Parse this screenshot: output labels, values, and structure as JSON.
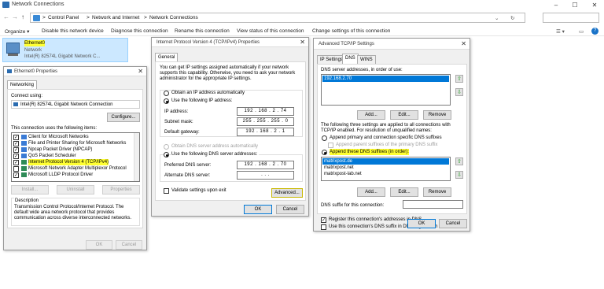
{
  "window": {
    "title": "Network Connections",
    "minimize": "–",
    "maximize": "☐",
    "close": "✕"
  },
  "address": {
    "back": "←",
    "forward": "→",
    "up": "↑",
    "crumbs": [
      "Control Panel",
      ">",
      "Network and Internet",
      ">",
      "Network Connections"
    ],
    "sep": ">",
    "search_placeholder": ""
  },
  "commands": [
    "Organize ▾",
    "Disable this network device",
    "Diagnose this connection",
    "Rename this connection",
    "View status of this connection",
    "Change settings of this connection"
  ],
  "adapter": {
    "name": "Ethernet0",
    "status": "Network",
    "device": "Intel(R) 82574L Gigabit Network C..."
  },
  "props": {
    "title": "Ethernet0 Properties",
    "tab": "Networking",
    "connect_using": "Connect using:",
    "device": "Intel(R) 82574L Gigabit Network Connection",
    "configure": "Configure...",
    "items_label": "This connection uses the following items:",
    "items": [
      "Client for Microsoft Networks",
      "File and Printer Sharing for Microsoft Networks",
      "Npcap Packet Driver (NPCAP)",
      "QoS Packet Scheduler",
      "Internet Protocol Version 4 (TCP/IPv4)",
      "Microsoft Network Adapter Multiplexor Protocol",
      "Microsoft LLDP Protocol Driver"
    ],
    "install": "Install...",
    "uninstall": "Uninstall",
    "properties": "Properties",
    "desc_label": "Description",
    "description": "Transmission Control Protocol/Internet Protocol. The default wide area network protocol that provides communication across diverse interconnected networks.",
    "ok": "OK",
    "cancel": "Cancel"
  },
  "ipv4": {
    "title": "Internet Protocol Version 4 (TCP/IPv4) Properties",
    "tab": "General",
    "intro": "You can get IP settings assigned automatically if your network supports this capability. Otherwise, you need to ask your network administrator for the appropriate IP settings.",
    "auto_ip": "Obtain an IP address automatically",
    "use_ip": "Use the following IP address:",
    "ip_label": "IP address:",
    "ip": "192 . 168 .  2  . 74",
    "mask_label": "Subnet mask:",
    "mask": "255 . 255 . 255 .  0",
    "gw_label": "Default gateway:",
    "gw": "192 . 168 .  2  .  1",
    "auto_dns": "Obtain DNS server address automatically",
    "use_dns": "Use the following DNS server addresses:",
    "pref_label": "Preferred DNS server:",
    "pref": "192 . 168 .  2  . 70",
    "alt_label": "Alternate DNS server:",
    "alt": " .  .  . ",
    "validate": "Validate settings upon exit",
    "advanced": "Advanced...",
    "ok": "OK",
    "cancel": "Cancel"
  },
  "adv": {
    "title": "Advanced TCP/IP Settings",
    "tabs": [
      "IP Settings",
      "DNS",
      "WINS"
    ],
    "dns_list_label": "DNS server addresses, in order of use:",
    "dns_servers": [
      "192.168.2.70"
    ],
    "add": "Add...",
    "edit": "Edit...",
    "remove": "Remove",
    "settings_text": "The following three settings are applied to all connections with TCP/IP enabled. For resolution of unqualified names:",
    "append_primary": "Append primary and connection specific DNS suffixes",
    "append_parent": "Append parent suffixes of the primary DNS suffix",
    "append_these": "Append these DNS suffixes (in order):",
    "suffixes": [
      "matrixpost.de",
      "matrixpost.net",
      "matrixpost-lab.net"
    ],
    "suffix_label": "DNS suffix for this connection:",
    "register": "Register this connection's addresses in DNS",
    "use_suffix": "Use this connection's DNS suffix in DNS registration",
    "ok": "OK",
    "cancel": "Cancel"
  }
}
